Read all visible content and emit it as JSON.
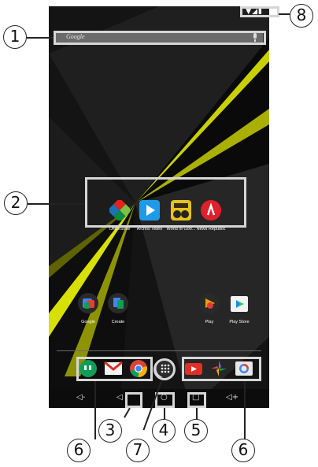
{
  "screen": {
    "search_placeholder": "Google",
    "status_icons": "▼◢▮"
  },
  "favorites": [
    {
      "label": "OfficeSuite"
    },
    {
      "label": "Archos Video"
    },
    {
      "label": "World of Goo..."
    },
    {
      "label": "News Republic"
    }
  ],
  "home_apps": [
    {
      "label": "Google"
    },
    {
      "label": "Create"
    },
    {
      "label": "Play"
    },
    {
      "label": "Play Store"
    }
  ],
  "dock": {
    "left_apps": [
      "hangouts-icon",
      "gmail-icon",
      "chrome-icon"
    ],
    "all_apps": "all-apps-icon",
    "right_apps": [
      "youtube-icon",
      "photos-icon",
      "camera-icon"
    ]
  },
  "navbar": {
    "vol_down": "◁-",
    "back": "◁",
    "home": "○",
    "recents": "□",
    "vol_up": "◁+"
  },
  "callouts": [
    "1",
    "2",
    "3",
    "4",
    "5",
    "6",
    "7",
    "6",
    "8"
  ],
  "colors": {
    "accent_yellow": "#d7e000",
    "wallpaper": "#121212",
    "outline": "#d6d6d6"
  }
}
